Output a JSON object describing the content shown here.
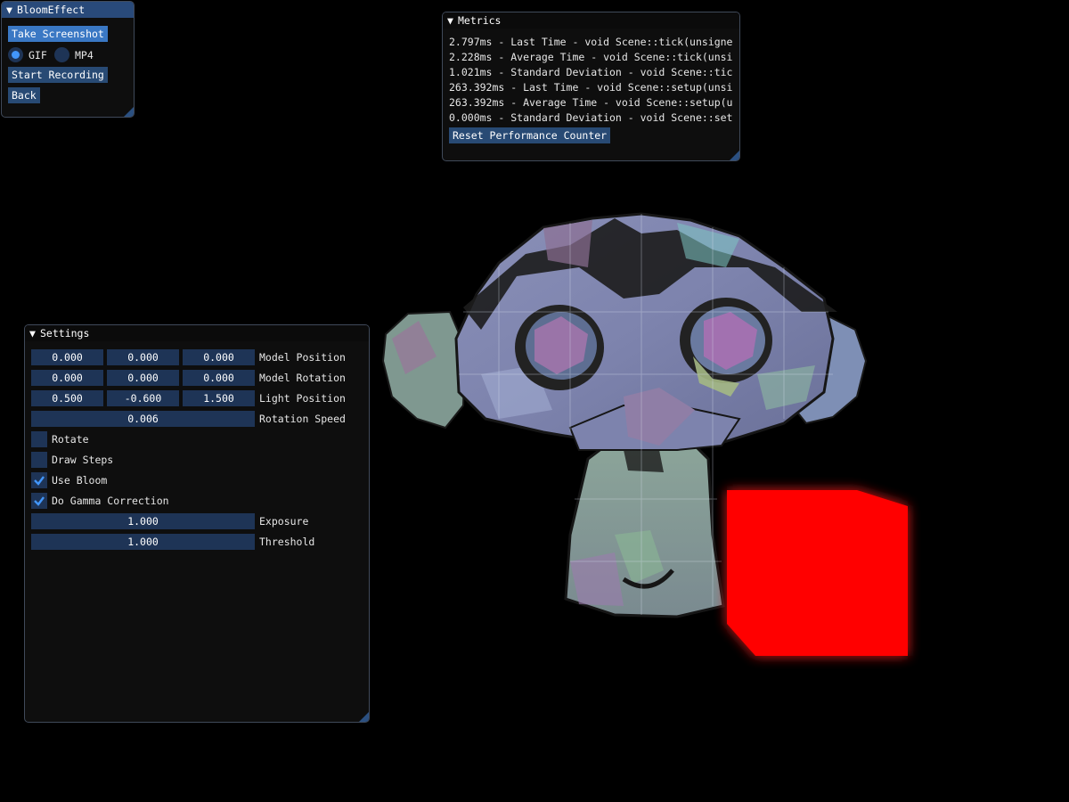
{
  "bloom_window": {
    "title": "BloomEffect",
    "take_screenshot": "Take Screenshot",
    "format_options": [
      {
        "label": "GIF",
        "selected": true
      },
      {
        "label": "MP4",
        "selected": false
      }
    ],
    "start_recording": "Start Recording",
    "back": "Back"
  },
  "metrics_window": {
    "title": "Metrics",
    "lines": [
      "2.797ms - Last Time - void Scene::tick(unsigne",
      "2.228ms - Average Time - void Scene::tick(unsi",
      "1.021ms - Standard Deviation - void Scene::tic",
      "263.392ms - Last Time - void Scene::setup(unsi",
      "263.392ms - Average Time - void Scene::setup(u",
      "0.000ms - Standard Deviation - void Scene::set"
    ],
    "reset_button": "Reset Performance Counter"
  },
  "settings_window": {
    "title": "Settings",
    "model_position": {
      "label": "Model Position",
      "values": [
        "0.000",
        "0.000",
        "0.000"
      ]
    },
    "model_rotation": {
      "label": "Model Rotation",
      "values": [
        "0.000",
        "0.000",
        "0.000"
      ]
    },
    "light_position": {
      "label": "Light Position",
      "values": [
        "0.500",
        "-0.600",
        "1.500"
      ]
    },
    "rotation_speed": {
      "label": "Rotation Speed",
      "value": "0.006"
    },
    "checkboxes": {
      "rotate": {
        "label": "Rotate",
        "checked": false
      },
      "draw_steps": {
        "label": "Draw Steps",
        "checked": false
      },
      "use_bloom": {
        "label": "Use Bloom",
        "checked": true
      },
      "gamma": {
        "label": "Do Gamma Correction",
        "checked": true
      }
    },
    "exposure": {
      "label": "Exposure",
      "value": "1.000"
    },
    "threshold": {
      "label": "Threshold",
      "value": "1.000"
    }
  },
  "scene": {
    "cube_color": "#ff0000",
    "glow_color": "#ff1a1a",
    "accent_color": "#4296fa"
  }
}
